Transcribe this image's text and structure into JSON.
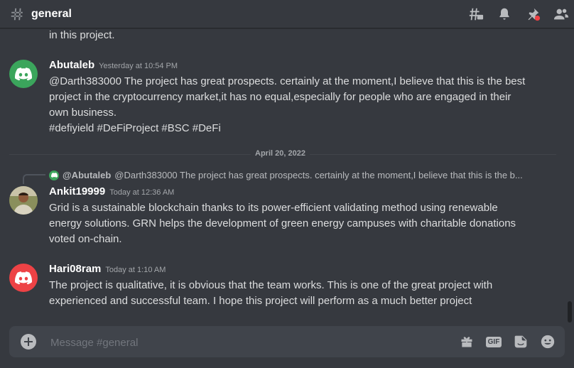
{
  "channel": {
    "name": "general"
  },
  "header": {
    "icons": [
      "threads-icon",
      "notification-bell-icon",
      "pinned-messages-icon",
      "member-list-icon"
    ]
  },
  "continuation_text": "in this project.",
  "messages": [
    {
      "username": "Abutaleb",
      "timestamp": "Yesterday at 10:54 PM",
      "avatar": "discord-logo-avatar",
      "avatar_color": "#3ba55c",
      "lines": [
        "@Darth383000 The project has great prospects. certainly at the moment,I believe that this is the best",
        "project in the cryptocurrency market,it has no equal,especially for people who are engaged in their",
        "own business.",
        "#defiyield #DeFiProject #BSC #DeFi"
      ]
    },
    {
      "username": "Ankit19999",
      "timestamp": "Today at 12:36 AM",
      "avatar": "user-photo-avatar",
      "reply": {
        "user": "@Abutaleb",
        "text": "@Darth383000 The project has great prospects. certainly at the moment,I believe that this is the b..."
      },
      "lines": [
        "Grid is a sustainable blockchain thanks to its power-efficient validating method using renewable",
        "energy solutions. GRN helps the development of green energy campuses with charitable donations",
        "voted on-chain."
      ]
    },
    {
      "username": "Hari08ram",
      "timestamp": "Today at 1:10 AM",
      "avatar": "discord-logo-avatar",
      "avatar_color": "#ed4245",
      "lines": [
        "The project is qualitative, it is obvious that the team works. This is one of the great project  with",
        "experienced and successful team. I hope this project will perform as a much better project"
      ]
    }
  ],
  "date_divider": "April 20, 2022",
  "composer": {
    "placeholder": "Message #general",
    "gif_label": "GIF",
    "icons": [
      "add-attachment-icon",
      "gift-icon",
      "gif-icon",
      "sticker-icon",
      "emoji-icon"
    ]
  }
}
